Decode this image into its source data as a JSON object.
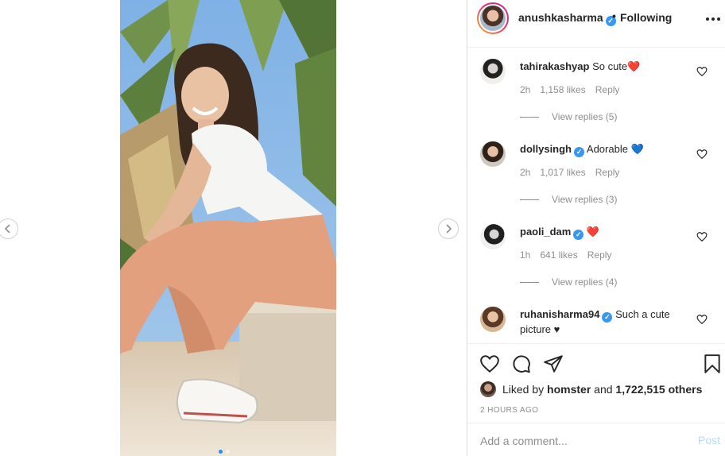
{
  "post": {
    "owner": {
      "username": "anushkasharma",
      "verified": true,
      "follow_state": "Following"
    },
    "more_icon": "more-horizontal-icon"
  },
  "comments": [
    {
      "username": "tahirakashyap",
      "verified": false,
      "text": "So cute",
      "emoji": "❤️",
      "age": "2h",
      "likes": "1,158 likes",
      "reply_label": "Reply",
      "view_replies": "View replies (5)"
    },
    {
      "username": "dollysingh",
      "verified": true,
      "text": "Adorable ",
      "emoji": "💙",
      "age": "2h",
      "likes": "1,017 likes",
      "reply_label": "Reply",
      "view_replies": "View replies (3)"
    },
    {
      "username": "paoli_dam",
      "verified": true,
      "text": "",
      "emoji": "❤️",
      "age": "1h",
      "likes": "641 likes",
      "reply_label": "Reply",
      "view_replies": "View replies (4)"
    },
    {
      "username": "ruhanisharma94",
      "verified": true,
      "text": "Such a cute picture",
      "emoji": "♥"
    }
  ],
  "actions": {
    "icons": [
      "heart-icon",
      "comment-icon",
      "share-icon",
      "bookmark-icon"
    ]
  },
  "likes": {
    "prefix": "Liked by",
    "user": "homster",
    "joiner": "and",
    "count": "1,722,515 others"
  },
  "timestamp": "2 HOURS AGO",
  "comment_box": {
    "placeholder": "Add a comment...",
    "post_label": "Post"
  },
  "carousel": {
    "slides": 2,
    "active_slide": 1
  },
  "colors": {
    "verified": "#3897f0",
    "post_disabled": "#b3dbff",
    "meta_gray": "#8e8e8e"
  }
}
